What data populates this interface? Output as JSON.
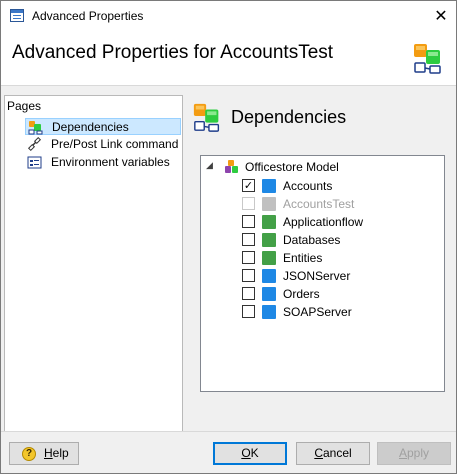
{
  "window": {
    "title": "Advanced Properties",
    "close_glyph": "✕"
  },
  "header": {
    "heading": "Advanced Properties for AccountsTest"
  },
  "pages": {
    "label": "Pages",
    "items": [
      {
        "label": "Dependencies",
        "icon": "dependencies-icon",
        "selected": true
      },
      {
        "label": "Pre/Post Link command",
        "icon": "link-command-icon",
        "selected": false
      },
      {
        "label": "Environment variables",
        "icon": "environment-variables-icon",
        "selected": false
      }
    ]
  },
  "content": {
    "title": "Dependencies",
    "tree": {
      "root": {
        "label": "Officestore Model",
        "expanded": true,
        "caret": "◢"
      },
      "items": [
        {
          "label": "Accounts",
          "checked": true,
          "disabled": false,
          "check_glyph": "✓",
          "icon_color": "#1e88e5"
        },
        {
          "label": "AccountsTest",
          "checked": false,
          "disabled": true,
          "check_glyph": "",
          "icon_color": "#b0b0b0"
        },
        {
          "label": "Applicationflow",
          "checked": false,
          "disabled": false,
          "check_glyph": "",
          "icon_color": "#43a047"
        },
        {
          "label": "Databases",
          "checked": false,
          "disabled": false,
          "check_glyph": "",
          "icon_color": "#43a047"
        },
        {
          "label": "Entities",
          "checked": false,
          "disabled": false,
          "check_glyph": "",
          "icon_color": "#43a047"
        },
        {
          "label": "JSONServer",
          "checked": false,
          "disabled": false,
          "check_glyph": "",
          "icon_color": "#1e88e5"
        },
        {
          "label": "Orders",
          "checked": false,
          "disabled": false,
          "check_glyph": "",
          "icon_color": "#1e88e5"
        },
        {
          "label": "SOAPServer",
          "checked": false,
          "disabled": false,
          "check_glyph": "",
          "icon_color": "#1e88e5"
        }
      ]
    }
  },
  "footer": {
    "help": {
      "label_mnemonic": "H",
      "label_rest": "elp",
      "icon_glyph": "?"
    },
    "ok": {
      "label_mnemonic": "O",
      "label_rest": "K"
    },
    "cancel": {
      "label_mnemonic": "C",
      "label_rest": "ancel"
    },
    "apply": {
      "label_mnemonic": "A",
      "label_rest": "pply",
      "enabled": false
    }
  },
  "colors": {
    "selection": "#cce8ff",
    "accent": "#0078d7",
    "icon_orange": "#f39c12"
  }
}
